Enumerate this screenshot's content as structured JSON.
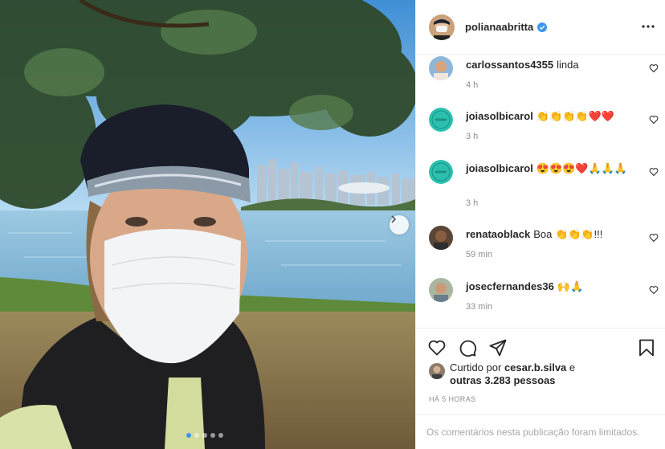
{
  "post": {
    "username": "polianaabritta",
    "verified": true,
    "more_icon": "ellipsis-icon",
    "carousel": {
      "slide_count": 5,
      "active_index": 0
    }
  },
  "comments": [
    {
      "user": "carlossantos4355",
      "text": "linda",
      "emoji": [],
      "time": "4 h"
    },
    {
      "user": "joiasolbicarol",
      "text": "",
      "emoji": [
        "👏",
        "👏",
        "👏",
        "👏",
        "❤️",
        "❤️"
      ],
      "time": "3 h"
    },
    {
      "user": "joiasolbicarol",
      "text": "",
      "emoji": [
        "😍",
        "😍",
        "😍",
        "❤️",
        "🙏",
        "🙏",
        "🙏"
      ],
      "time": "3 h"
    },
    {
      "user": "renataoblack",
      "text": "Boa",
      "emoji": [
        "👏",
        "👏",
        "👏"
      ],
      "suffix": "!!!",
      "time": "59 min"
    },
    {
      "user": "josecfernandes36",
      "text": "",
      "emoji": [
        "🙌",
        "🙏"
      ],
      "time": "33 min"
    }
  ],
  "likes": {
    "prefix": "Curtido por",
    "user": "cesar.b.silva",
    "conjunction": "e",
    "others": "outras 3.283 pessoas"
  },
  "posted_time": "HÁ 5 HORAS",
  "comments_limited": "Os comentários nesta publicação foram limitados.",
  "colors": {
    "verified_blue": "#3897f0",
    "muted_text": "#8e8e8e",
    "divider": "#efefef",
    "teal_avatar": "#2bbfae"
  }
}
